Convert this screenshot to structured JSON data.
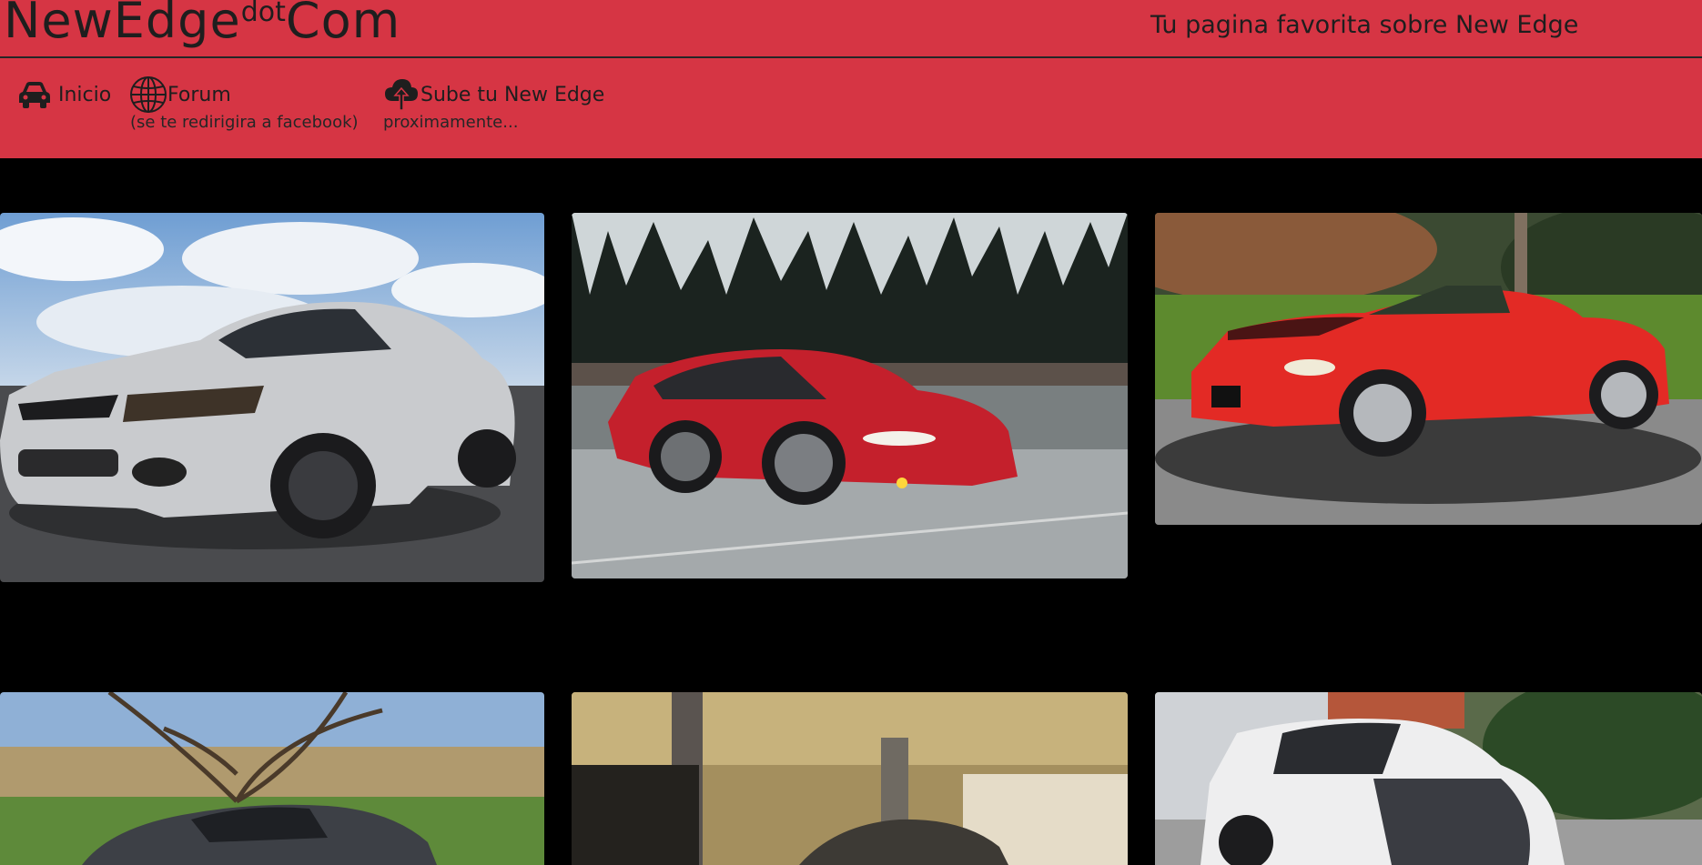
{
  "header": {
    "brand_part1": "NewEdge",
    "brand_part2": "dot",
    "brand_part3": "Com",
    "tagline": "Tu pagina favorita sobre New Edge"
  },
  "nav": {
    "inicio_label": "Inicio",
    "forum_label": "Forum",
    "forum_sub": "(se te redirigira a facebook)",
    "upload_label": "Sube tu New Edge",
    "upload_sub": "proximamente..."
  },
  "icons": {
    "inicio": "car-icon",
    "forum": "globe-icon",
    "upload": "cloud-upload-icon"
  },
  "colors": {
    "header_bg": "#d63544",
    "page_bg": "#000000",
    "text": "#1e1e1e"
  }
}
